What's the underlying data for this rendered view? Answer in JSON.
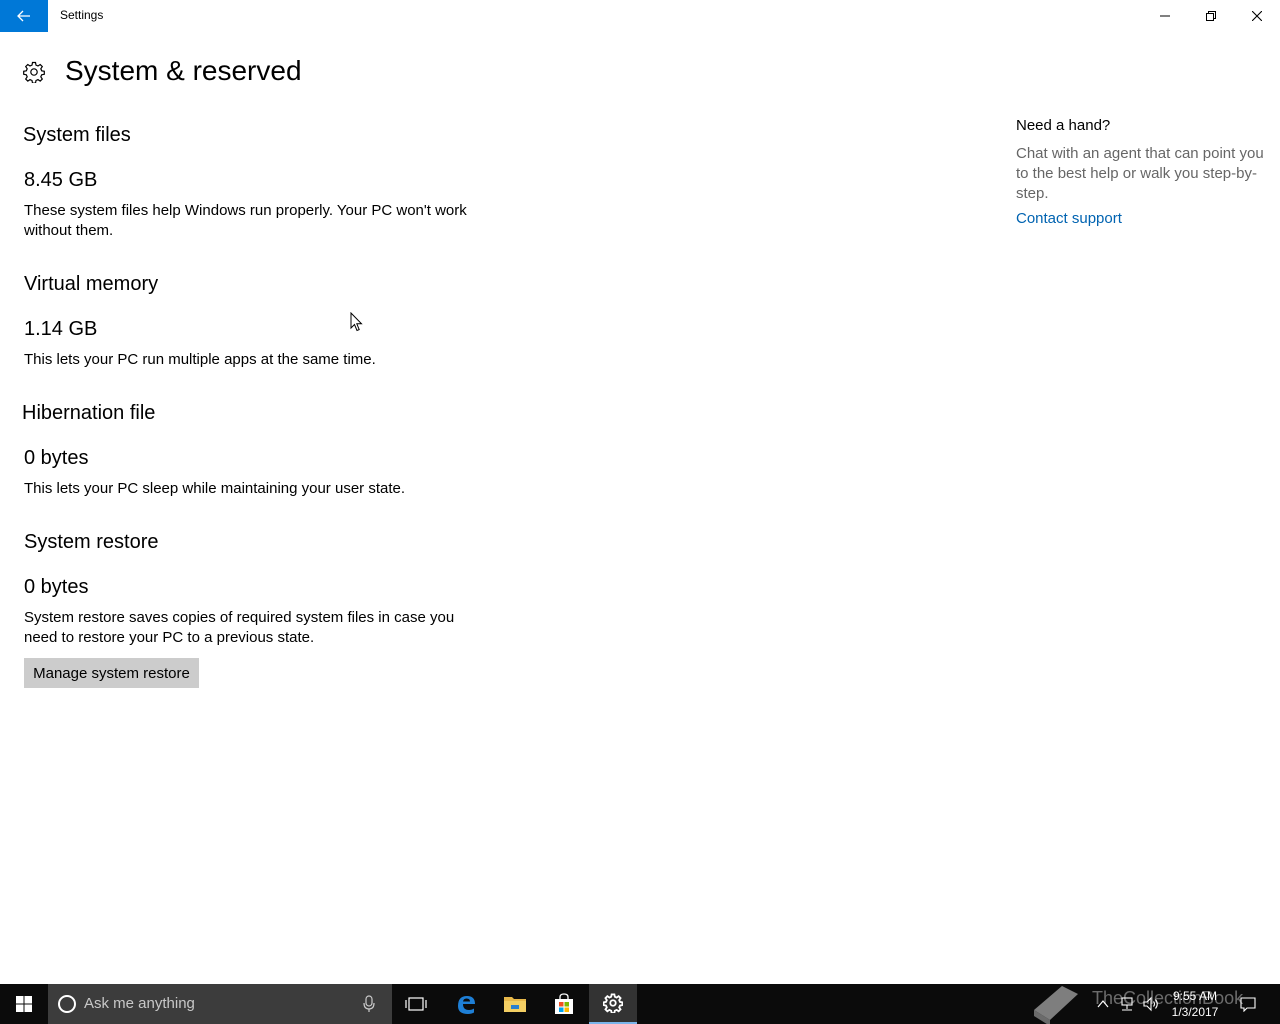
{
  "window": {
    "title": "Settings"
  },
  "page": {
    "title": "System & reserved"
  },
  "sections": [
    {
      "title": "System files",
      "size": "8.45 GB",
      "description": "These system files help Windows run properly. Your PC won't work without them."
    },
    {
      "title": "Virtual memory",
      "size": "1.14 GB",
      "description": "This lets your PC run multiple apps at the same time."
    },
    {
      "title": "Hibernation file",
      "size": "0 bytes",
      "description": "This lets your PC sleep while maintaining your user state."
    },
    {
      "title": "System restore",
      "size": "0 bytes",
      "description": "System restore saves copies of required system files in case you need to restore your PC to a previous state."
    }
  ],
  "manage_button": "Manage system restore",
  "help": {
    "title": "Need a hand?",
    "text": "Chat with an agent that can point you to the best help or walk you step-by-step.",
    "link": "Contact support"
  },
  "taskbar": {
    "search_placeholder": "Ask me anything",
    "time": "9:55 AM",
    "date": "1/3/2017",
    "watermark": "TheCollectionBook"
  },
  "colors": {
    "accent": "#0078d7",
    "link": "#0063b1",
    "taskbar": "#0b0b0b"
  }
}
